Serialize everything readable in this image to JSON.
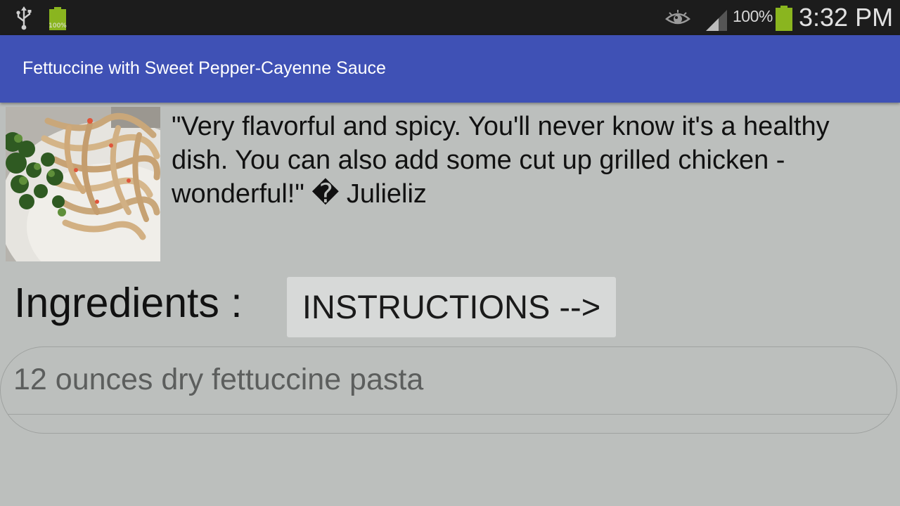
{
  "status_bar": {
    "small_battery_label": "100%",
    "battery_percent": "100%",
    "time": "3:32 PM",
    "icons": [
      "usb-icon",
      "battery-small-icon",
      "eye-icon",
      "signal-icon",
      "battery-icon"
    ]
  },
  "app_bar": {
    "title": "Fettuccine with Sweet Pepper-Cayenne Sauce",
    "color": "#3f51b5"
  },
  "recipe": {
    "quote": "\"Very flavorful and spicy. You'll never know it's a healthy dish. You can also add some cut up grilled chicken - wonderful!\" � Julieliz",
    "ingredients_label": "Ingredients :",
    "instructions_button": "INSTRUCTIONS -->",
    "ingredients": [
      "12 ounces dry fettuccine pasta"
    ]
  },
  "colors": {
    "background": "#bcbfbd",
    "status_bar": "#1c1c1c",
    "battery_green": "#8ab51f"
  }
}
